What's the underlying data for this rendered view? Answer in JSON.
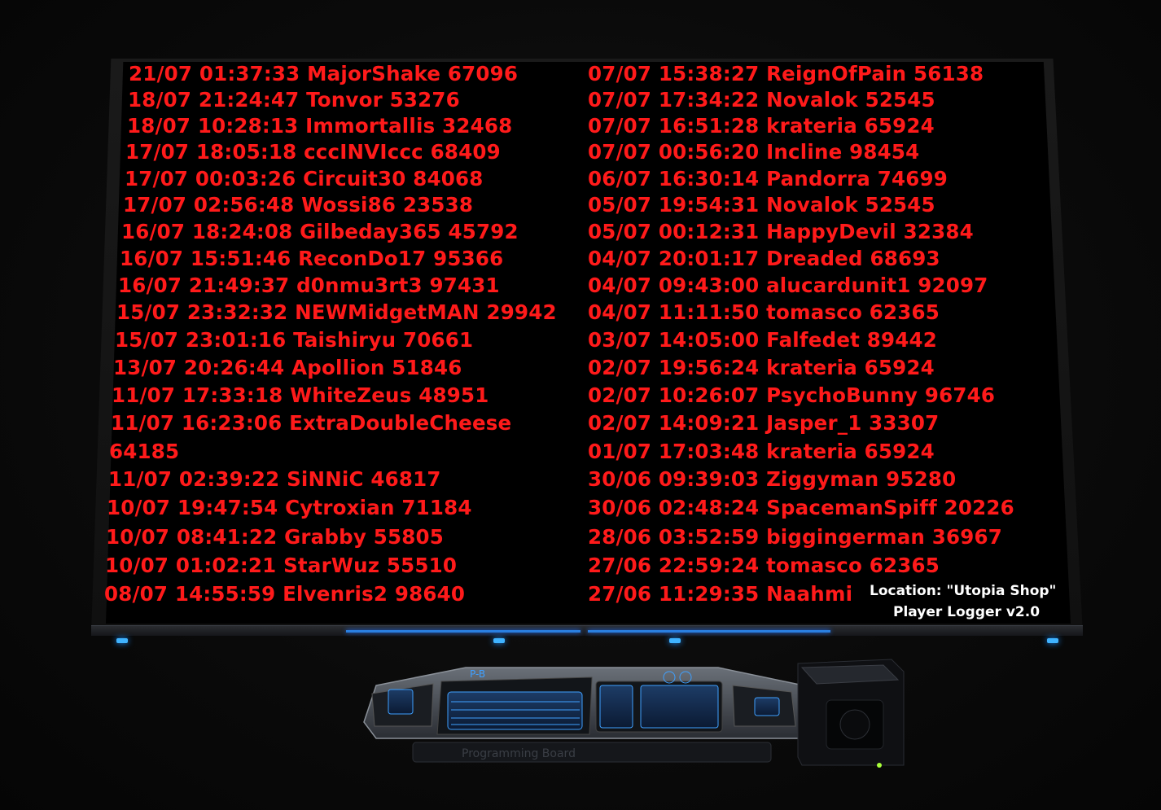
{
  "log_left": [
    "21/07 01:37:33 MajorShake 67096",
    "18/07 21:24:47 Tonvor 53276",
    "18/07 10:28:13 Immortallis 32468",
    "17/07 18:05:18 cccINVIccc 68409",
    "17/07 00:03:26 Circuit30 84068",
    "17/07 02:56:48 Wossi86 23538",
    "16/07 18:24:08 Gilbeday365 45792",
    "16/07 15:51:46 ReconDo17 95366",
    "16/07 21:49:37 d0nmu3rt3 97431",
    "15/07 23:32:32 NEWMidgetMAN 29942",
    "15/07 23:01:16 Taishiryu 70661",
    "13/07 20:26:44 Apollion 51846",
    "11/07 17:33:18 WhiteZeus 48951",
    "11/07 16:23:06 ExtraDoubleCheese",
    "64185",
    "11/07 02:39:22 SiNNiC 46817",
    "10/07 19:47:54 Cytroxian 71184",
    "10/07 08:41:22 Grabby 55805",
    "10/07 01:02:21 StarWuz 55510",
    "08/07 14:55:59 Elvenris2 98640"
  ],
  "log_right": [
    "07/07 15:38:27 ReignOfPain 56138",
    "07/07 17:34:22 Novalok 52545",
    "07/07 16:51:28 krateria 65924",
    "07/07 00:56:20 Incline 98454",
    "06/07 16:30:14 Pandorra 74699",
    "05/07 19:54:31 Novalok 52545",
    "05/07 00:12:31 HappyDevil 32384",
    "04/07 20:01:17 Dreaded 68693",
    "04/07 09:43:00 alucardunit1 92097",
    "04/07 11:11:50 tomasco 62365",
    "03/07 14:05:00 Falfedet 89442",
    "02/07 19:56:24 krateria 65924",
    "02/07 10:26:07 PsychoBunny 96746",
    "02/07 14:09:21 Jasper_1 33307",
    "01/07 17:03:48 krateria 65924",
    "30/06 09:39:03 Ziggyman 95280",
    "30/06 02:48:24 SpacemanSpiff 20226",
    "28/06 03:52:59 biggingerman 36967",
    "27/06 22:59:24 tomasco 62365",
    "27/06 11:29:35 Naahmi"
  ],
  "location": "Location: \"Utopia Shop\"",
  "logger_name": "Player Logger v2.0",
  "board_label": "Programming Board",
  "board_badge": "P-B",
  "colors": {
    "text": "#ff1a1a",
    "led": "#3fb3ff",
    "panel": "#000000"
  }
}
